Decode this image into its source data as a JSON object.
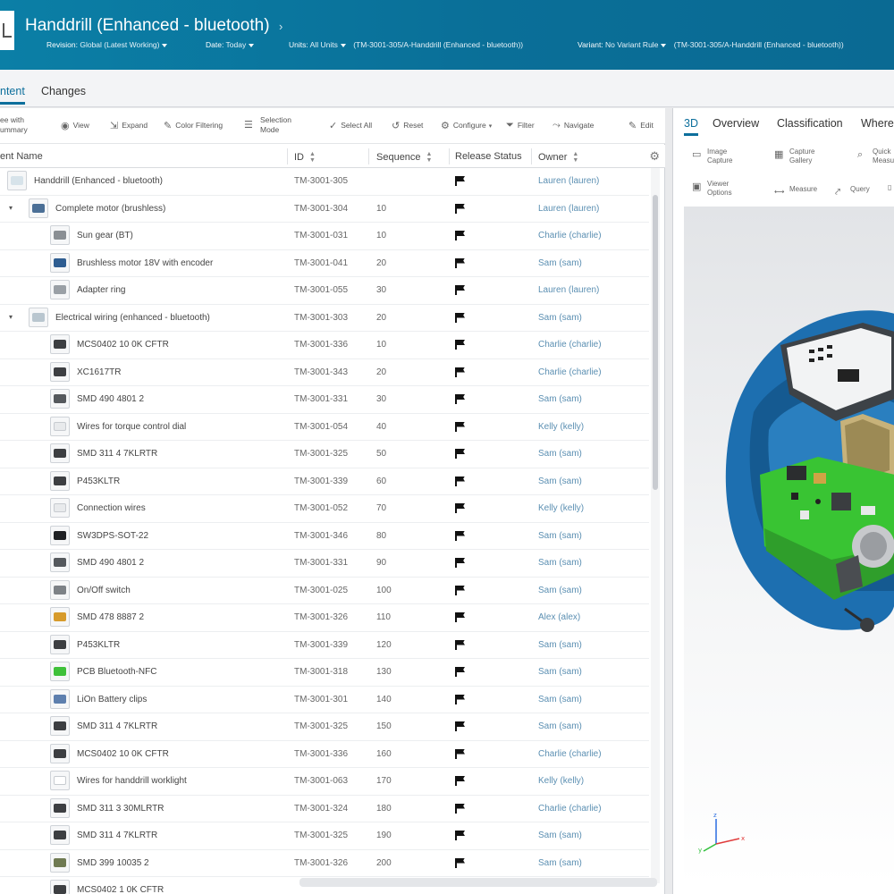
{
  "header": {
    "title": "Handdrill (Enhanced - bluetooth)",
    "revision_label": "Revision:",
    "revision_value": "Global (Latest Working)",
    "date_label": "Date:",
    "date_value": "Today",
    "units_label": "Units:",
    "units_value": "All Units",
    "units_context": "(TM-3001-305/A-Handdrill (Enhanced - bluetooth))",
    "variant_label": "Variant:",
    "variant_value": "No Variant Rule",
    "variant_context": "(TM-3001-305/A-Handdrill (Enhanced - bluetooth))"
  },
  "subtabs": [
    "ntent",
    "Changes"
  ],
  "toolbar": {
    "tree_summary": [
      "ee with",
      "ummary"
    ],
    "view": "View",
    "expand": "Expand",
    "color_filtering": "Color Filtering",
    "selection_mode": [
      "Selection",
      "Mode"
    ],
    "select_all": "Select All",
    "reset": "Reset",
    "configure": "Configure",
    "filter": "Filter",
    "navigate": "Navigate",
    "edit": "Edit"
  },
  "columns": {
    "name": "ent Name",
    "id": "ID",
    "sequence": "Sequence",
    "release_status": "Release Status",
    "owner": "Owner"
  },
  "rows": [
    {
      "level": 0,
      "twisty": "",
      "name": "Handdrill (Enhanced - bluetooth)",
      "id": "TM-3001-305",
      "seq": "",
      "owner": "Lauren (lauren)",
      "thumb": "#d7e3ea"
    },
    {
      "level": 1,
      "twisty": "▾",
      "name": "Complete motor (brushless)",
      "id": "TM-3001-304",
      "seq": "10",
      "owner": "Lauren (lauren)",
      "thumb": "#4b6f96"
    },
    {
      "level": 2,
      "twisty": "",
      "name": "Sun gear (BT)",
      "id": "TM-3001-031",
      "seq": "10",
      "owner": "Charlie (charlie)",
      "thumb": "#8a8f94"
    },
    {
      "level": 2,
      "twisty": "",
      "name": "Brushless motor 18V with encoder",
      "id": "TM-3001-041",
      "seq": "20",
      "owner": "Sam (sam)",
      "thumb": "#2e5d91"
    },
    {
      "level": 2,
      "twisty": "",
      "name": "Adapter ring",
      "id": "TM-3001-055",
      "seq": "30",
      "owner": "Lauren (lauren)",
      "thumb": "#9aa0a6"
    },
    {
      "level": 1,
      "twisty": "▾",
      "name": "Electrical wiring (enhanced - bluetooth)",
      "id": "TM-3001-303",
      "seq": "20",
      "owner": "Sam (sam)",
      "thumb": "#b9c6cf"
    },
    {
      "level": 2,
      "twisty": "",
      "name": "MCS0402 10 0K CFTR",
      "id": "TM-3001-336",
      "seq": "10",
      "owner": "Charlie (charlie)",
      "thumb": "#3d3f42"
    },
    {
      "level": 2,
      "twisty": "",
      "name": "XC1617TR",
      "id": "TM-3001-343",
      "seq": "20",
      "owner": "Charlie (charlie)",
      "thumb": "#3d3f42"
    },
    {
      "level": 2,
      "twisty": "",
      "name": "SMD 490 4801 2",
      "id": "TM-3001-331",
      "seq": "30",
      "owner": "Sam (sam)",
      "thumb": "#55595d"
    },
    {
      "level": 2,
      "twisty": "",
      "name": "Wires for torque control dial",
      "id": "TM-3001-054",
      "seq": "40",
      "owner": "Kelly (kelly)",
      "thumb": "#e8eaec"
    },
    {
      "level": 2,
      "twisty": "",
      "name": "SMD 311 4 7KLRTR",
      "id": "TM-3001-325",
      "seq": "50",
      "owner": "Sam (sam)",
      "thumb": "#3d3f42"
    },
    {
      "level": 2,
      "twisty": "",
      "name": "P453KLTR",
      "id": "TM-3001-339",
      "seq": "60",
      "owner": "Sam (sam)",
      "thumb": "#3d3f42"
    },
    {
      "level": 2,
      "twisty": "",
      "name": "Connection wires",
      "id": "TM-3001-052",
      "seq": "70",
      "owner": "Kelly (kelly)",
      "thumb": "#e8eaec"
    },
    {
      "level": 2,
      "twisty": "",
      "name": "SW3DPS-SOT-22",
      "id": "TM-3001-346",
      "seq": "80",
      "owner": "Sam (sam)",
      "thumb": "#1f2124"
    },
    {
      "level": 2,
      "twisty": "",
      "name": "SMD 490 4801 2",
      "id": "TM-3001-331",
      "seq": "90",
      "owner": "Sam (sam)",
      "thumb": "#55595d"
    },
    {
      "level": 2,
      "twisty": "",
      "name": "On/Off switch",
      "id": "TM-3001-025",
      "seq": "100",
      "owner": "Sam (sam)",
      "thumb": "#7d8287"
    },
    {
      "level": 2,
      "twisty": "",
      "name": "SMD 478 8887 2",
      "id": "TM-3001-326",
      "seq": "110",
      "owner": "Alex (alex)",
      "thumb": "#d79b2b"
    },
    {
      "level": 2,
      "twisty": "",
      "name": "P453KLTR",
      "id": "TM-3001-339",
      "seq": "120",
      "owner": "Sam (sam)",
      "thumb": "#3d3f42"
    },
    {
      "level": 2,
      "twisty": "",
      "name": "PCB Bluetooth-NFC",
      "id": "TM-3001-318",
      "seq": "130",
      "owner": "Sam (sam)",
      "thumb": "#3fc13a"
    },
    {
      "level": 2,
      "twisty": "",
      "name": "LiOn Battery clips",
      "id": "TM-3001-301",
      "seq": "140",
      "owner": "Sam (sam)",
      "thumb": "#5d7fae"
    },
    {
      "level": 2,
      "twisty": "",
      "name": "SMD 311 4 7KLRTR",
      "id": "TM-3001-325",
      "seq": "150",
      "owner": "Sam (sam)",
      "thumb": "#3d3f42"
    },
    {
      "level": 2,
      "twisty": "",
      "name": "MCS0402 10 0K CFTR",
      "id": "TM-3001-336",
      "seq": "160",
      "owner": "Charlie (charlie)",
      "thumb": "#3d3f42"
    },
    {
      "level": 2,
      "twisty": "",
      "name": "Wires for handdrill worklight",
      "id": "TM-3001-063",
      "seq": "170",
      "owner": "Kelly (kelly)",
      "thumb": "#ffffff"
    },
    {
      "level": 2,
      "twisty": "",
      "name": "SMD 311 3 30MLRTR",
      "id": "TM-3001-324",
      "seq": "180",
      "owner": "Charlie (charlie)",
      "thumb": "#3d3f42"
    },
    {
      "level": 2,
      "twisty": "",
      "name": "SMD 311 4 7KLRTR",
      "id": "TM-3001-325",
      "seq": "190",
      "owner": "Sam (sam)",
      "thumb": "#3d3f42"
    },
    {
      "level": 2,
      "twisty": "",
      "name": "SMD 399 10035 2",
      "id": "TM-3001-326",
      "seq": "200",
      "owner": "Sam (sam)",
      "thumb": "#6f7a52"
    },
    {
      "level": 2,
      "twisty": "",
      "name": "MCS0402 1 0K CFTR",
      "id": "",
      "seq": "",
      "owner": "",
      "thumb": "#3d3f42"
    }
  ],
  "right_tabs": [
    "3D",
    "Overview",
    "Classification",
    "Where"
  ],
  "right_tools": {
    "image_capture": [
      "Image",
      "Capture"
    ],
    "capture_gallery": [
      "Capture",
      "Gallery"
    ],
    "quick_measure": [
      "Quick",
      "Measu"
    ],
    "viewer_options": [
      "Viewer",
      "Options"
    ],
    "measure": "Measure",
    "query": "Query"
  },
  "colors": {
    "header_bg": "#0a7aa3",
    "accent": "#0d6f9c",
    "owner_link": "#5b8fb2",
    "model_blue": "#1d6fb0",
    "pcb_green": "#39c433"
  }
}
